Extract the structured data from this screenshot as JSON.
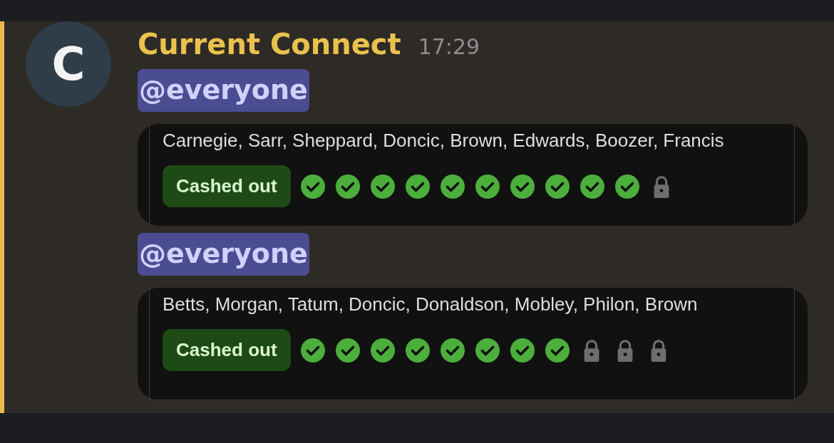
{
  "message": {
    "author": "Current Connect",
    "time": "17:29",
    "avatar": {
      "letter": "C"
    }
  },
  "posts": [
    {
      "mention": "@everyone",
      "card": {
        "players": "Carnegie, Sarr, Sheppard, Doncic, Brown, Edwards, Boozer, Francis",
        "badge": "Cashed out",
        "legs": [
          {
            "kind": "check"
          },
          {
            "kind": "check"
          },
          {
            "kind": "check"
          },
          {
            "kind": "check"
          },
          {
            "kind": "check"
          },
          {
            "kind": "check"
          },
          {
            "kind": "check"
          },
          {
            "kind": "check"
          },
          {
            "kind": "check"
          },
          {
            "kind": "check"
          },
          {
            "kind": "lock"
          }
        ]
      }
    },
    {
      "mention": "@everyone",
      "card": {
        "players": "Betts, Morgan, Tatum, Doncic, Donaldson, Mobley, Philon, Brown",
        "badge": "Cashed out",
        "legs": [
          {
            "kind": "check"
          },
          {
            "kind": "check"
          },
          {
            "kind": "check"
          },
          {
            "kind": "check"
          },
          {
            "kind": "check"
          },
          {
            "kind": "check"
          },
          {
            "kind": "check"
          },
          {
            "kind": "check"
          },
          {
            "kind": "lock"
          },
          {
            "kind": "lock"
          },
          {
            "kind": "lock"
          }
        ]
      }
    }
  ]
}
